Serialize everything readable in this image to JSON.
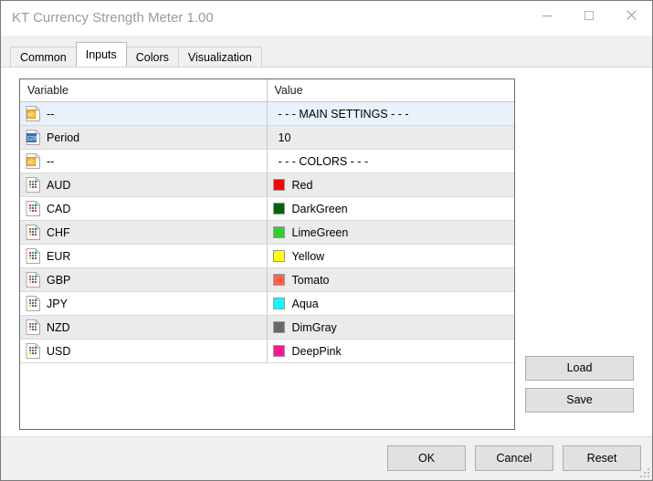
{
  "window": {
    "title": "KT Currency Strength Meter 1.00",
    "controls": [
      {
        "name": "minimize",
        "label": "Minimize"
      },
      {
        "name": "maximize",
        "label": "Maximize"
      },
      {
        "name": "close",
        "label": "Close"
      }
    ]
  },
  "tabs": [
    {
      "label": "Common",
      "active": false
    },
    {
      "label": "Inputs",
      "active": true
    },
    {
      "label": "Colors",
      "active": false
    },
    {
      "label": "Visualization",
      "active": false
    }
  ],
  "grid": {
    "headers": {
      "variable": "Variable",
      "value": "Value"
    },
    "rows": [
      {
        "icon": "ab-icon",
        "variable": "--",
        "value": "- - - MAIN SETTINGS - - -",
        "swatch": null,
        "style": "selected"
      },
      {
        "icon": "123-icon",
        "variable": "Period",
        "value": "10",
        "swatch": null,
        "style": "alt"
      },
      {
        "icon": "ab-icon",
        "variable": "--",
        "value": "- - - COLORS - - -",
        "swatch": null,
        "style": "plain"
      },
      {
        "icon": "color-icon",
        "variable": "AUD",
        "value": "Red",
        "swatch": "#FF0000",
        "style": "alt"
      },
      {
        "icon": "color-icon",
        "variable": "CAD",
        "value": "DarkGreen",
        "swatch": "#006400",
        "style": "plain"
      },
      {
        "icon": "color-icon",
        "variable": "CHF",
        "value": "LimeGreen",
        "swatch": "#32CD32",
        "style": "alt"
      },
      {
        "icon": "color-icon",
        "variable": "EUR",
        "value": "Yellow",
        "swatch": "#FFFF00",
        "style": "plain"
      },
      {
        "icon": "color-icon",
        "variable": "GBP",
        "value": "Tomato",
        "swatch": "#FF6347",
        "style": "alt"
      },
      {
        "icon": "color-icon",
        "variable": "JPY",
        "value": "Aqua",
        "swatch": "#00FFFF",
        "style": "plain"
      },
      {
        "icon": "color-icon",
        "variable": "NZD",
        "value": "DimGray",
        "swatch": "#696969",
        "style": "alt"
      },
      {
        "icon": "color-icon",
        "variable": "USD",
        "value": "DeepPink",
        "swatch": "#FF1493",
        "style": "plain"
      }
    ]
  },
  "side_buttons": {
    "load": "Load",
    "save": "Save"
  },
  "footer_buttons": {
    "ok": "OK",
    "cancel": "Cancel",
    "reset": "Reset"
  }
}
